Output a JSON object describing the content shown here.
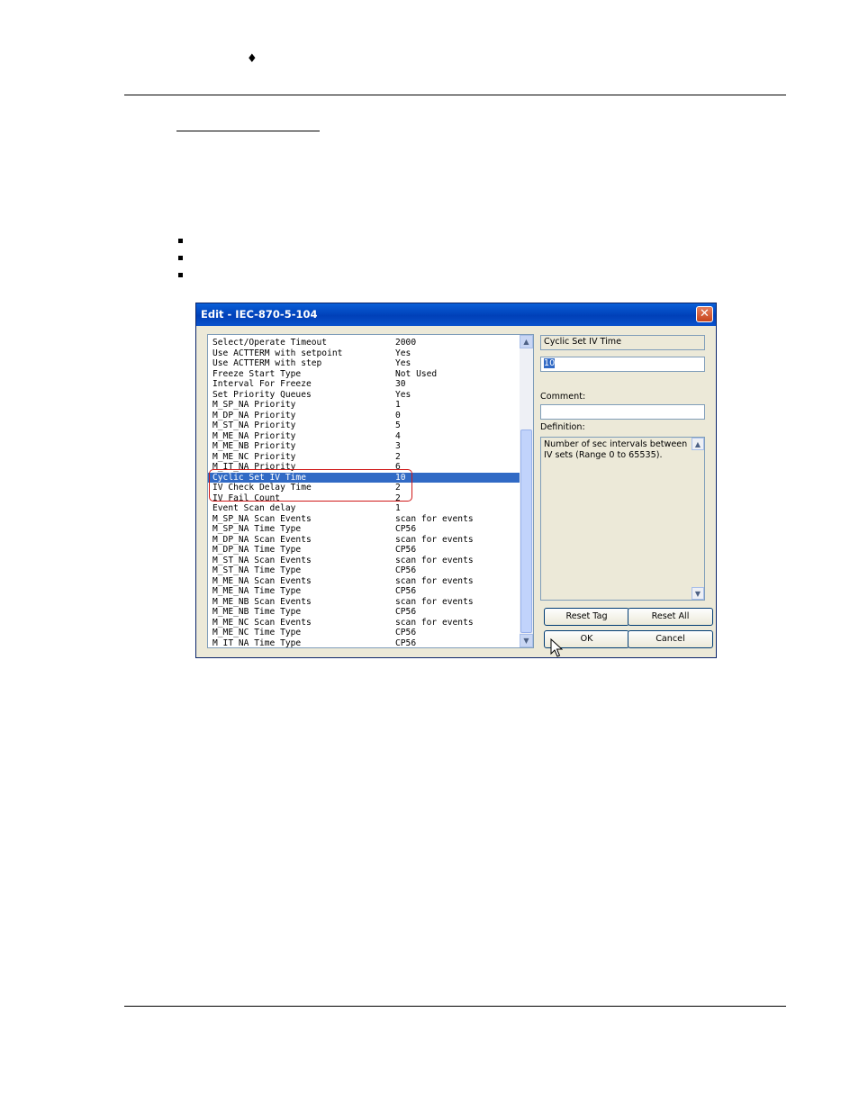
{
  "page": {
    "header_glyph": "♦"
  },
  "dialog": {
    "title": "Edit - IEC-870-5-104",
    "close_glyph": "✕",
    "params": [
      {
        "name": "Select/Operate Timeout",
        "value": "2000"
      },
      {
        "name": "Use ACTTERM with setpoint",
        "value": "Yes"
      },
      {
        "name": "Use ACTTERM with step",
        "value": "Yes"
      },
      {
        "name": "Freeze Start Type",
        "value": "Not Used"
      },
      {
        "name": "Interval For Freeze",
        "value": "30"
      },
      {
        "name": "Set Priority Queues",
        "value": "Yes"
      },
      {
        "name": "M_SP_NA Priority",
        "value": "1"
      },
      {
        "name": "M_DP_NA Priority",
        "value": "0"
      },
      {
        "name": "M_ST_NA Priority",
        "value": "5"
      },
      {
        "name": "M_ME_NA Priority",
        "value": "4"
      },
      {
        "name": "M_ME_NB Priority",
        "value": "3"
      },
      {
        "name": "M_ME_NC Priority",
        "value": "2"
      },
      {
        "name": "M_IT_NA Priority",
        "value": "6"
      },
      {
        "name": "Cyclic Set IV Time",
        "value": "10",
        "selected": true
      },
      {
        "name": "IV Check Delay Time",
        "value": "2"
      },
      {
        "name": "IV Fail Count",
        "value": "2"
      },
      {
        "name": "Event Scan delay",
        "value": "1"
      },
      {
        "name": "M_SP_NA Scan Events",
        "value": "scan for events"
      },
      {
        "name": "M_SP_NA Time Type",
        "value": "CP56"
      },
      {
        "name": "M_DP_NA Scan Events",
        "value": "scan for events"
      },
      {
        "name": "M_DP_NA Time Type",
        "value": "CP56"
      },
      {
        "name": "M_ST_NA Scan Events",
        "value": "scan for events"
      },
      {
        "name": "M_ST_NA Time Type",
        "value": "CP56"
      },
      {
        "name": "M_ME_NA Scan Events",
        "value": "scan for events"
      },
      {
        "name": "M_ME_NA Time Type",
        "value": "CP56"
      },
      {
        "name": "M_ME_NB Scan Events",
        "value": "scan for events"
      },
      {
        "name": "M_ME_NB Time Type",
        "value": "CP56"
      },
      {
        "name": "M_ME_NC Scan Events",
        "value": "scan for events"
      },
      {
        "name": "M_ME_NC Time Type",
        "value": "CP56"
      },
      {
        "name": "M_IT_NA Time Type",
        "value": "CP56"
      }
    ],
    "param_name": "Cyclic Set IV Time",
    "param_value": "10",
    "comment_label": "Comment:",
    "comment_value": "",
    "definition_label": "Definition:",
    "definition_text": "Number of sec intervals between IV sets (Range 0 to 65535).",
    "buttons": {
      "reset_tag": "Reset Tag",
      "reset_all": "Reset All",
      "ok": "OK",
      "cancel": "Cancel"
    }
  }
}
